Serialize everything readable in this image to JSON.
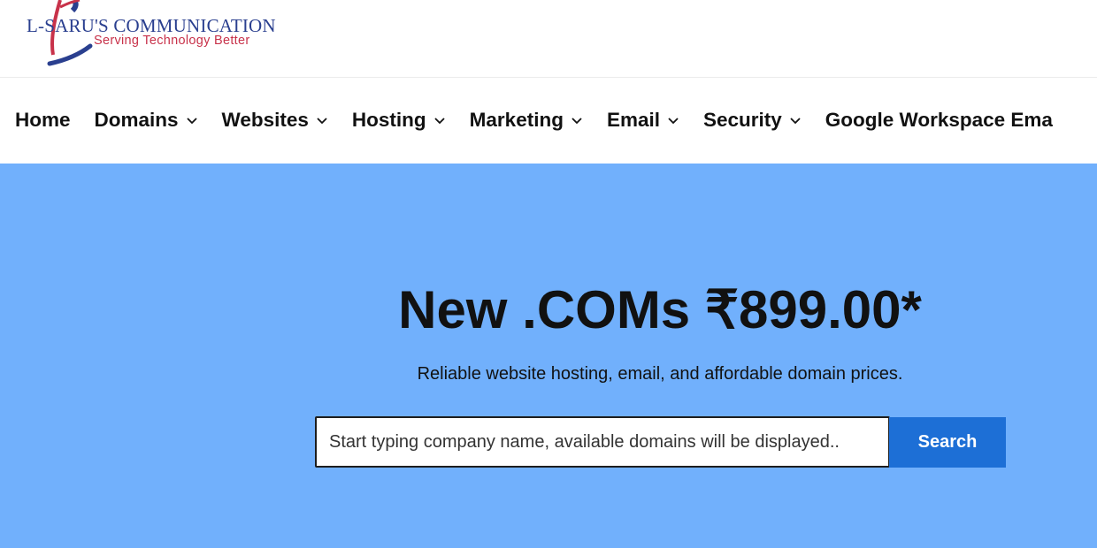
{
  "brand": {
    "name": "L-SARU'S COMMUNICATION",
    "tagline": "Serving Technology Better",
    "logo_icon": "swoosh-logo-icon"
  },
  "nav": {
    "items": [
      {
        "label": "Home",
        "has_dropdown": false
      },
      {
        "label": "Domains",
        "has_dropdown": true
      },
      {
        "label": "Websites",
        "has_dropdown": true
      },
      {
        "label": "Hosting",
        "has_dropdown": true
      },
      {
        "label": "Marketing",
        "has_dropdown": true
      },
      {
        "label": "Email",
        "has_dropdown": true
      },
      {
        "label": "Security",
        "has_dropdown": true
      },
      {
        "label": "Google Workspace Ema",
        "has_dropdown": false
      }
    ],
    "dropdown_icon": "chevron-down-icon"
  },
  "hero": {
    "title": "New .COMs ₹899.00*",
    "subtitle": "Reliable website hosting, email, and affordable domain prices.",
    "search_placeholder": "Start typing company name, available domains will be displayed..",
    "search_button": "Search"
  },
  "colors": {
    "hero_background": "#71b0fc",
    "search_button": "#1d6fd6",
    "brand_blue": "#2a3f8f",
    "brand_red": "#c8324a"
  }
}
